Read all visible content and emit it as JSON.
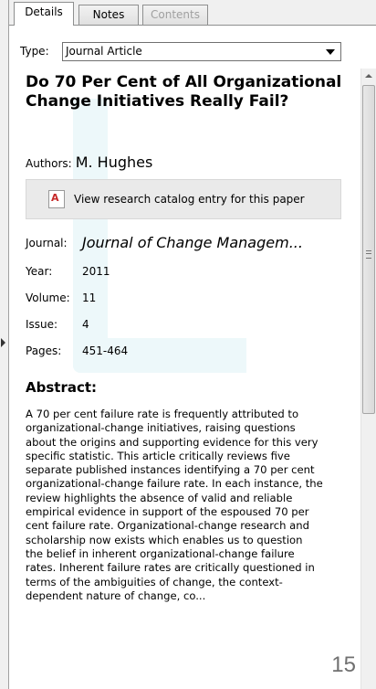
{
  "tabs": [
    {
      "label": "Details",
      "state": "active"
    },
    {
      "label": "Notes",
      "state": "normal"
    },
    {
      "label": "Contents",
      "state": "disabled"
    }
  ],
  "type": {
    "label": "Type:",
    "value": "Journal Article"
  },
  "title": "Do 70 Per Cent of All Organizational Change Initiatives Really Fail?",
  "authors": {
    "label": "Authors:",
    "value": "M. Hughes"
  },
  "catalog_button": {
    "label": "View research catalog entry for this paper",
    "icon": "pdf-icon"
  },
  "meta": {
    "journal": {
      "label": "Journal:",
      "value": "Journal of Change Managem..."
    },
    "year": {
      "label": "Year:",
      "value": "2011"
    },
    "volume": {
      "label": "Volume:",
      "value": "11"
    },
    "issue": {
      "label": "Issue:",
      "value": "4"
    },
    "pages": {
      "label": "Pages:",
      "value": "451-464"
    }
  },
  "abstract": {
    "heading": "Abstract:",
    "text": "A 70 per cent failure rate is frequently attributed to organizational-change initiatives, raising questions about the origins and supporting evidence for this very specific statistic. This article critically reviews five separate published instances identifying a 70 per cent organizational-change failure rate. In each instance, the review highlights the absence of valid and reliable empirical evidence in support of the espoused 70 per cent failure rate. Organizational-change research and scholarship now exists which enables us to question the belief in inherent organizational-change failure rates. Inherent failure rates are critically questioned in terms of the ambiguities of change, the context-dependent nature of change, co..."
  },
  "page_number": "15",
  "colors": {
    "watermark": "#dff3f7",
    "pdf_icon": "#c62828"
  }
}
